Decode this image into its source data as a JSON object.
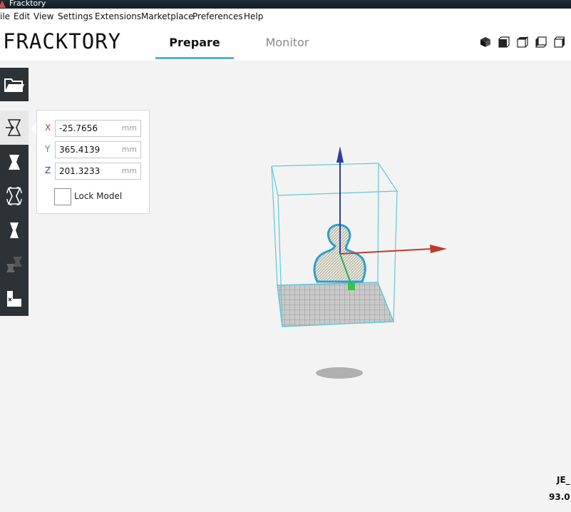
{
  "window": {
    "title": "Fracktory"
  },
  "menu": [
    "ile",
    "Edit",
    "View",
    "Settings",
    "Extensions",
    "Marketplace",
    "Preferences",
    "Help"
  ],
  "header": {
    "logo": "FRACKTORY",
    "tabs": [
      {
        "label": "Prepare",
        "active": true
      },
      {
        "label": "Monitor",
        "active": false
      }
    ],
    "view_icons": [
      "view-3d-icon",
      "view-front-icon",
      "view-top-icon",
      "view-left-icon",
      "view-right-icon"
    ]
  },
  "toolbar": {
    "open": "folder-icon",
    "tools": [
      "move-icon",
      "scale-icon",
      "rotate-icon",
      "mirror-icon",
      "per-model-settings-icon",
      "support-blocker-icon"
    ]
  },
  "move_panel": {
    "x": {
      "axis": "X",
      "value": "-25.7656",
      "unit": "mm",
      "color": "#c0392b"
    },
    "y": {
      "axis": "Y",
      "value": "365.4139",
      "unit": "mm",
      "color": "#27ae60"
    },
    "z": {
      "axis": "Z",
      "value": "201.3233",
      "unit": "mm",
      "color": "#2c3e9e"
    },
    "lock_label": "Lock Model"
  },
  "status": {
    "line1": "JE_",
    "line2": "93.0"
  },
  "colors": {
    "accent": "#4bb4d6",
    "toolbar_bg": "#2c3236",
    "bbox": "#5ec8e0"
  }
}
